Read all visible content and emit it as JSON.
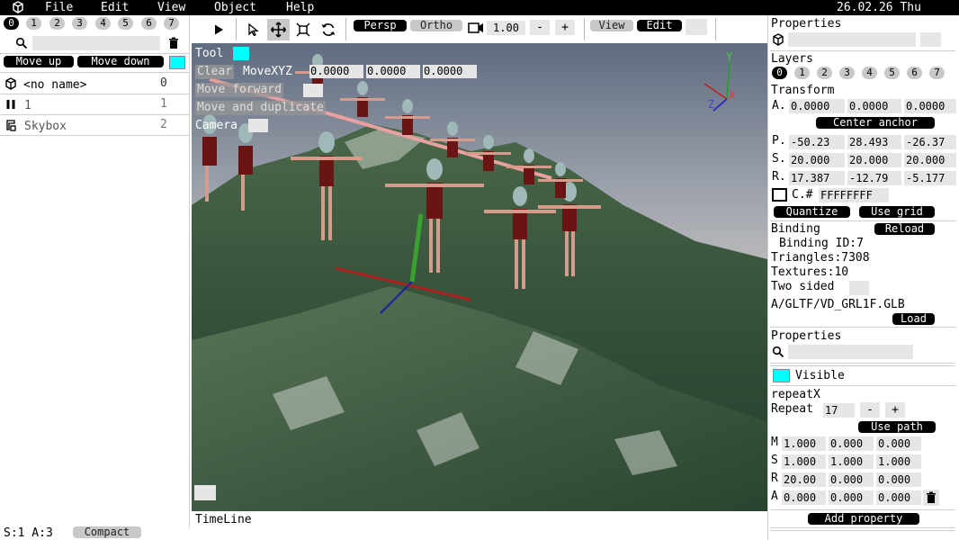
{
  "menu": {
    "items": [
      "File",
      "Edit",
      "View",
      "Object",
      "Help"
    ],
    "clock": "26.02.26 Thu 19:52"
  },
  "left": {
    "layers": [
      "0",
      "1",
      "2",
      "3",
      "4",
      "5",
      "6",
      "7"
    ],
    "search_value": "",
    "move_up": "Move up",
    "move_down": "Move down",
    "scene": [
      {
        "icon": "cube-icon",
        "name": "<no name>",
        "index": "0"
      },
      {
        "icon": "pause-icon",
        "name": "1",
        "index": "1"
      },
      {
        "icon": "skybox-icon",
        "name": "Skybox",
        "index": "2"
      }
    ]
  },
  "toolbar": {
    "persp": "Persp",
    "ortho": "Ortho",
    "camera_value": "1.00",
    "minus": "-",
    "plus": "+",
    "view": "View",
    "edit": "Edit"
  },
  "viewport": {
    "tool_label": "Tool",
    "clear": "Clear",
    "move_xyz": "MoveXYZ",
    "xyz": [
      "0.0000",
      "0.0000",
      "0.0000"
    ],
    "move_forward": "Move forward",
    "move_dup": "Move and duplicate",
    "camera": "Camera",
    "axis_x": "X",
    "axis_y": "Y",
    "axis_z": "Z"
  },
  "bottom": {
    "timeline": "TimeLine",
    "status": "S:1 A:3",
    "compact": "Compact"
  },
  "right": {
    "properties_title": "Properties",
    "layers_title": "Layers",
    "layers": [
      "0",
      "1",
      "2",
      "3",
      "4",
      "5",
      "6",
      "7"
    ],
    "transform_title": "Transform",
    "anchor_label": "A.",
    "anchor": [
      "0.0000",
      "0.0000",
      "0.0000"
    ],
    "center_anchor": "Center anchor",
    "pos_label": "P.",
    "pos": [
      "-50.23",
      "28.493",
      "-26.37"
    ],
    "scale_label": "S.",
    "scale": [
      "20.000",
      "20.000",
      "20.000"
    ],
    "rot_label": "R.",
    "rot": [
      "17.387",
      "-12.79",
      "-5.177"
    ],
    "color_label": "C.#",
    "color_value": "FFFFFFFF",
    "quantize": "Quantize",
    "use_grid": "Use grid",
    "binding_title": "Binding",
    "reload": "Reload",
    "binding_id": "Binding ID:7",
    "triangles": "Triangles:7308",
    "textures": "Textures:10",
    "two_sided": "Two sided",
    "file_path": "A/GLTF/VD_GRL1F.GLB",
    "load": "Load",
    "properties2_title": "Properties",
    "visible": "Visible",
    "repeat_name": "repeatX",
    "repeat_label": "Repeat",
    "repeat_value": "17",
    "use_path": "Use path",
    "m_label": "M",
    "m": [
      "1.000",
      "0.000",
      "0.000"
    ],
    "s_label": "S",
    "s": [
      "1.000",
      "1.000",
      "1.000"
    ],
    "r_label": "R",
    "r": [
      "20.00",
      "0.000",
      "0.000"
    ],
    "a_label": "A",
    "a": [
      "0.000",
      "0.000",
      "0.000"
    ],
    "add_property": "Add property"
  },
  "colors": {
    "accent": "#00ffff",
    "bar": "#000000",
    "field": "#e6e6e6"
  }
}
